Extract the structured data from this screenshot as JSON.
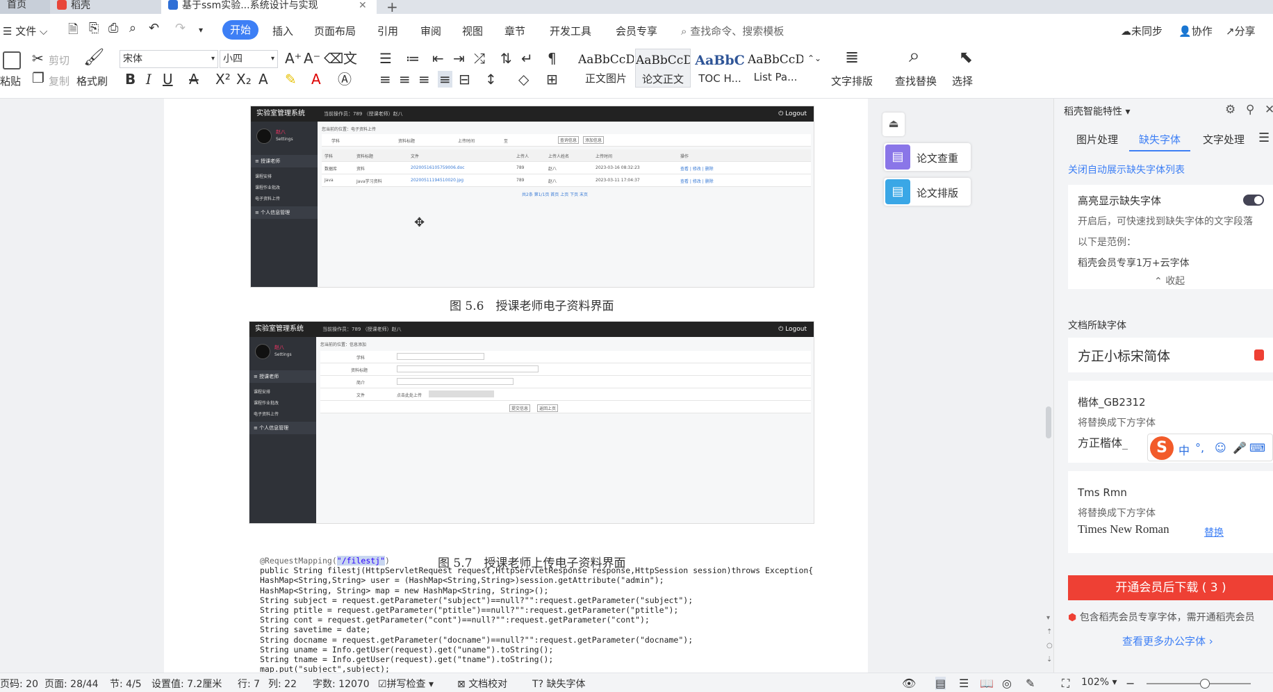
{
  "tabs": {
    "home": "首页",
    "daoke": "稻壳",
    "doc": "基于ssm实验...系统设计与实现"
  },
  "menubar": {
    "file": "文件",
    "items": [
      "开始",
      "插入",
      "页面布局",
      "引用",
      "审阅",
      "视图",
      "章节",
      "开发工具",
      "会员专享"
    ],
    "search_placeholder": "查找命令、搜索模板",
    "sync": "未同步",
    "collab": "协作",
    "share": "分享"
  },
  "ribbon": {
    "paste": "粘贴",
    "cut": "剪切",
    "copy": "复制",
    "format_painter": "格式刷",
    "font_name": "宋体",
    "font_size": "小四",
    "styles": [
      {
        "preview": "AaBbCcDd",
        "name": "正文图片"
      },
      {
        "preview": "AaBbCcD",
        "name": "论文正文"
      },
      {
        "preview": "AaBbC",
        "name": "TOC H..."
      },
      {
        "preview": "AaBbCcD",
        "name": "List Pa..."
      }
    ],
    "text_layout": "文字排版",
    "find_replace": "查找替换",
    "select": "选择"
  },
  "doc": {
    "fig1": {
      "app_title": "实验室管理系统",
      "operator": "当前操作员：789 （授课老师）赵八",
      "logout": "Logout",
      "user": "赵八",
      "settings": "Settings",
      "group1": "授课老师",
      "menu": [
        "课程安排",
        "课程作业批改",
        "电子资料上传"
      ],
      "group2": "个人信息管理",
      "breadcrumb": "您当前的位置：电子资料上传",
      "filters": [
        "学科",
        "资料标题",
        "上传时间",
        "至"
      ],
      "buttons": [
        "查询信息",
        "添加信息"
      ],
      "headers": [
        "学科",
        "资料标题",
        "文件",
        "上传人",
        "上传人姓名",
        "上传时间",
        "操作"
      ],
      "rows": [
        [
          "数据库",
          "资料",
          "20200516105759006.doc",
          "789",
          "赵八",
          "2023-03-16 08:32:23",
          "查看 | 修改 | 删除"
        ],
        [
          "Java",
          "Java学习资料",
          "20200511194510020.jpg",
          "789",
          "赵八",
          "2023-03-11 17:04:37",
          "查看 | 修改 | 删除"
        ]
      ],
      "pager": "共2条 第1/1页 首页 上页 下页 末页"
    },
    "caption1": "图 5.6　授课老师电子资料界面",
    "fig2": {
      "app_title": "实验室管理系统",
      "operator": "当前操作员：789 （授课老师）赵八",
      "logout": "Logout",
      "breadcrumb": "您当前的位置：信息添加",
      "fields": [
        "学科",
        "资料标题",
        "简介",
        "文件"
      ],
      "upload": "点击此处上传",
      "buttons": [
        "提交信息",
        "返回上页"
      ]
    },
    "caption2": "图 5.7　授课老师上传电子资料界面",
    "code": [
      "@RequestMapping(\"/filestj\")",
      "public String filestj(HttpServletRequest request,HttpServletResponse response,HttpSession session)throws Exception{",
      "HashMap<String,String> user = (HashMap<String,String>)session.getAttribute(\"admin\");",
      "HashMap<String, String> map = new HashMap<String, String>();",
      "String subject = request.getParameter(\"subject\")==null?\"\":request.getParameter(\"subject\");",
      "String ptitle = request.getParameter(\"ptitle\")==null?\"\":request.getParameter(\"ptitle\");",
      "String cont = request.getParameter(\"cont\")==null?\"\":request.getParameter(\"cont\");",
      "String savetime = date;",
      "String docname = request.getParameter(\"docname\")==null?\"\":request.getParameter(\"docname\");",
      "String uname = Info.getUser(request).get(\"uname\").toString();",
      "String tname = Info.getUser(request).get(\"tname\").toString();",
      "map.put(\"subject\",subject);"
    ]
  },
  "floating": {
    "check": "论文查重",
    "layout": "论文排版"
  },
  "panel": {
    "title": "稻壳智能特性",
    "tabs": [
      "图片处理",
      "缺失字体",
      "文字处理"
    ],
    "close_auto": "关闭自动展示缺失字体列表",
    "highlight_title": "高亮显示缺失字体",
    "highlight_desc": "开启后，可快速找到缺失字体的文字段落",
    "example_label": "以下是范例：",
    "example_text": "稻壳会员专享1万+云字体",
    "collapse": "收起",
    "missing_title": "文档所缺字体",
    "font1": "方正小标宋简体",
    "font2": "楷体_GB2312",
    "replace_label": "将替换成下方字体",
    "font2_replace": "方正楷体_",
    "font3": "Tms Rmn",
    "font3_replace": "Times New Roman",
    "replace_btn": "替换",
    "download": "开通会员后下载 ( 3 )",
    "note": "包含稻壳会员专享字体，需开通稻壳会员",
    "more": "查看更多办公字体"
  },
  "ime": {
    "lang": "中",
    "punct": "°,"
  },
  "status": {
    "page_code": "页码: 20",
    "page": "页面: 28/44",
    "section": "节: 4/5",
    "setting": "设置值: 7.2厘米",
    "row": "行: 7",
    "col": "列: 22",
    "words": "字数: 12070",
    "spell": "拼写检查",
    "proof": "文档校对",
    "missing_font": "缺失字体",
    "zoom": "102%"
  }
}
